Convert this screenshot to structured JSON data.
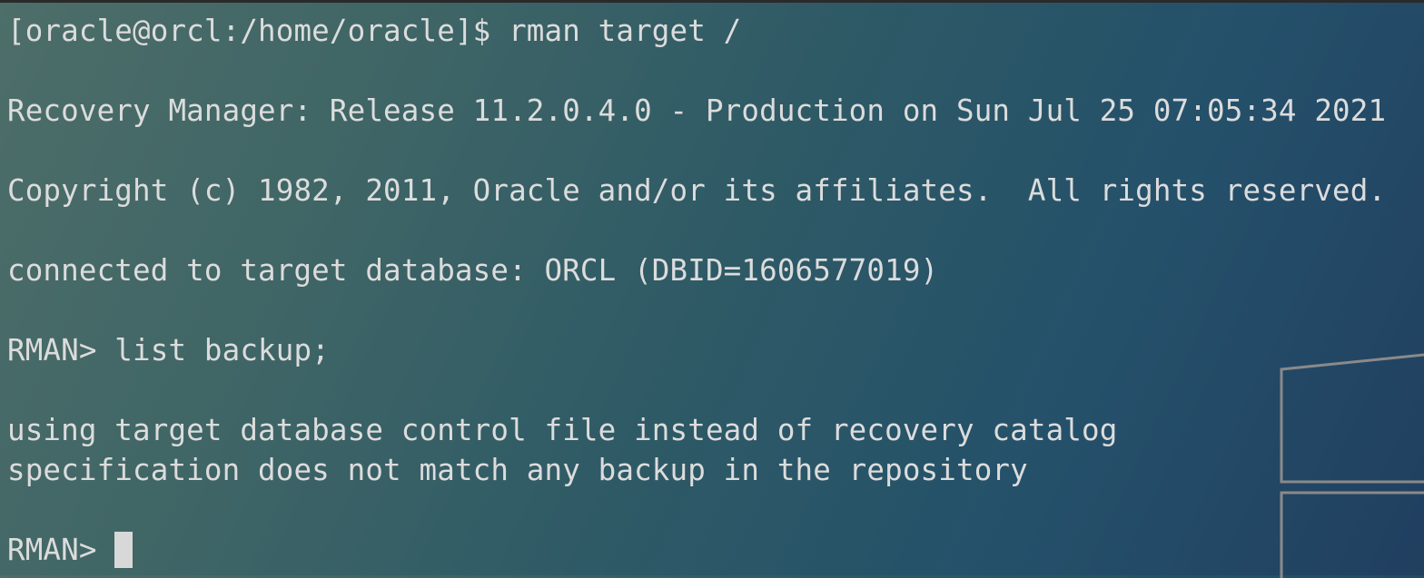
{
  "terminal": {
    "lines": [
      "[oracle@orcl:/home/oracle]$ rman target /",
      "",
      "Recovery Manager: Release 11.2.0.4.0 - Production on Sun Jul 25 07:05:34 2021",
      "",
      "Copyright (c) 1982, 2011, Oracle and/or its affiliates.  All rights reserved.",
      "",
      "connected to target database: ORCL (DBID=1606577019)",
      "",
      "RMAN> list backup;",
      "",
      "using target database control file instead of recovery catalog",
      "specification does not match any backup in the repository",
      "",
      "RMAN> "
    ]
  }
}
